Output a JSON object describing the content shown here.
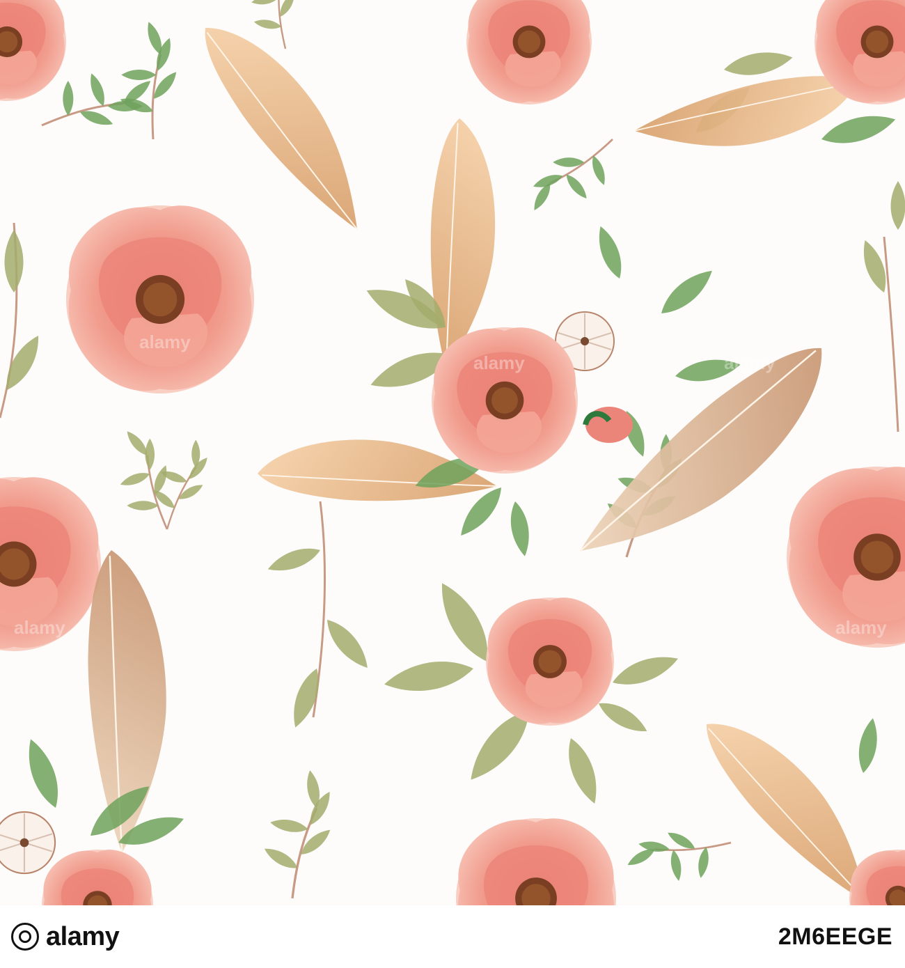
{
  "image": {
    "description_colors": {
      "background": "#fdfcfa",
      "peony_light": "#f4a99a",
      "peony_mid": "#ec8a7d",
      "peony_dark": "#d96a60",
      "peony_center": "#7a3e22",
      "feather_light": "#f3c9a0",
      "feather_dark": "#c8915e",
      "feather_brown": "#b98b66",
      "leaf_green": "#6fa25c",
      "leaf_olive": "#a3ab6c",
      "stem": "#c89a86",
      "cotton": "#faf1ea"
    },
    "watermark_text": "alamy"
  },
  "footer": {
    "brand": "alamy",
    "image_id": "2M6EEGE"
  }
}
